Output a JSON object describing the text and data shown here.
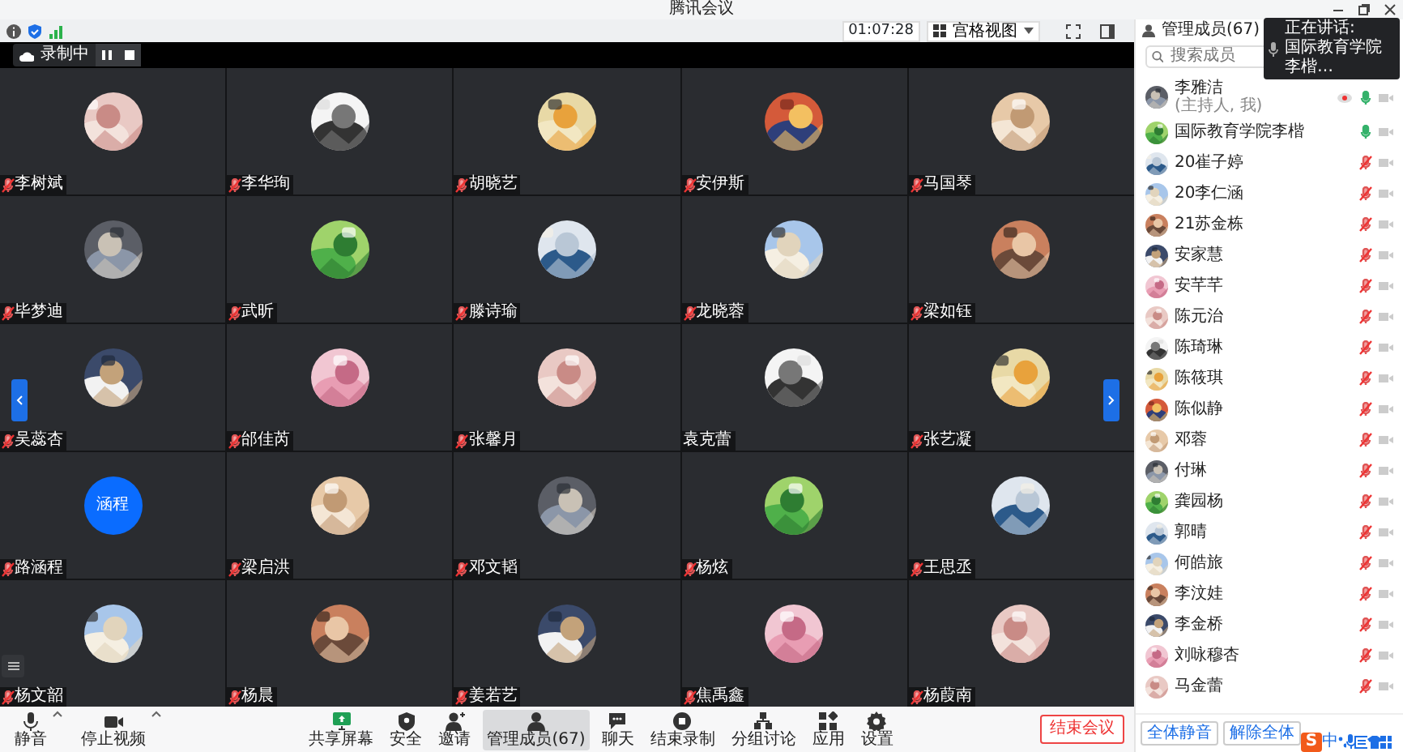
{
  "window": {
    "title": "腾讯会议"
  },
  "toolbar": {
    "timer": "01:07:28",
    "view_menu": "宫格视图"
  },
  "recording": {
    "label": "录制中"
  },
  "tiles": [
    {
      "name": "李树斌",
      "muted": true
    },
    {
      "name": "李华珣",
      "muted": true
    },
    {
      "name": "胡晓艺",
      "muted": true
    },
    {
      "name": "安伊斯",
      "muted": true
    },
    {
      "name": "马国琴",
      "muted": true
    },
    {
      "name": "毕梦迪",
      "muted": true
    },
    {
      "name": "武昕",
      "muted": true
    },
    {
      "name": "滕诗瑜",
      "muted": true
    },
    {
      "name": "龙晓蓉",
      "muted": true
    },
    {
      "name": "梁如钰",
      "muted": true
    },
    {
      "name": "吴蕊杏",
      "muted": true
    },
    {
      "name": "邰佳芮",
      "muted": true
    },
    {
      "name": "张馨月",
      "muted": true
    },
    {
      "name": "袁克蕾",
      "muted": false
    },
    {
      "name": "张艺凝",
      "muted": true
    },
    {
      "name": "路涵程",
      "muted": true,
      "avatar": {
        "kind": "initials",
        "text": "涵程"
      }
    },
    {
      "name": "梁启洪",
      "muted": true
    },
    {
      "name": "邓文韬",
      "muted": true
    },
    {
      "name": "杨炫",
      "muted": true
    },
    {
      "name": "王思丞",
      "muted": true
    },
    {
      "name": "杨文韶",
      "muted": true
    },
    {
      "name": "杨晨",
      "muted": true
    },
    {
      "name": "姜若艺",
      "muted": true
    },
    {
      "name": "焦禹鑫",
      "muted": true
    },
    {
      "name": "杨葭南",
      "muted": true
    }
  ],
  "controls_left": [
    {
      "label": "静音",
      "kind": "mic"
    },
    {
      "label": "停止视频",
      "kind": "camera"
    }
  ],
  "controls_center": [
    {
      "label": "共享屏幕",
      "kind": "share",
      "selected": false
    },
    {
      "label": "安全",
      "kind": "security",
      "selected": false
    },
    {
      "label": "邀请",
      "kind": "invite",
      "selected": false
    },
    {
      "label": "管理成员(67)",
      "kind": "members",
      "selected": true
    },
    {
      "label": "聊天",
      "kind": "chat",
      "selected": false
    },
    {
      "label": "结束录制",
      "kind": "record",
      "selected": false
    },
    {
      "label": "分组讨论",
      "kind": "breakout",
      "selected": false
    },
    {
      "label": "应用",
      "kind": "apps",
      "selected": false
    },
    {
      "label": "设置",
      "kind": "settings",
      "selected": false
    }
  ],
  "end_button": "结束会议",
  "panel": {
    "title": "管理成员(67)",
    "search": {
      "placeholder": "搜索成员"
    },
    "speaking_toast": [
      "正在讲话:",
      "国际教育学院",
      "李楷…"
    ],
    "members": [
      {
        "name": "李雅洁",
        "note": "(主持人, 我)",
        "video_on": true,
        "muted": false
      },
      {
        "name": "国际教育学院李楷",
        "video_on": false,
        "muted": false
      },
      {
        "name": "20崔子婷",
        "video_on": false,
        "muted": true
      },
      {
        "name": "20李仁涵",
        "video_on": false,
        "muted": true
      },
      {
        "name": "21苏金栋",
        "video_on": false,
        "muted": true
      },
      {
        "name": "安家慧",
        "video_on": false,
        "muted": true
      },
      {
        "name": "安芊芊",
        "video_on": false,
        "muted": true
      },
      {
        "name": "陈元治",
        "video_on": false,
        "muted": true
      },
      {
        "name": "陈琦琳",
        "video_on": false,
        "muted": true
      },
      {
        "name": "陈筱琪",
        "video_on": false,
        "muted": true
      },
      {
        "name": "陈似静",
        "video_on": false,
        "muted": true
      },
      {
        "name": "邓蓉",
        "video_on": false,
        "muted": true
      },
      {
        "name": "付琳",
        "video_on": false,
        "muted": true
      },
      {
        "name": "龚园杨",
        "video_on": false,
        "muted": true
      },
      {
        "name": "郭晴",
        "video_on": false,
        "muted": true
      },
      {
        "name": "何皓旅",
        "video_on": false,
        "muted": true
      },
      {
        "name": "李汶娃",
        "video_on": false,
        "muted": true
      },
      {
        "name": "李金桥",
        "video_on": false,
        "muted": true
      },
      {
        "name": "刘咏穆杏",
        "video_on": false,
        "muted": true
      },
      {
        "name": "马金蕾",
        "video_on": false,
        "muted": true
      }
    ],
    "buttons": [
      "全体静音",
      "解除全体"
    ]
  },
  "ime": {
    "logo": "S",
    "lang": "中"
  }
}
